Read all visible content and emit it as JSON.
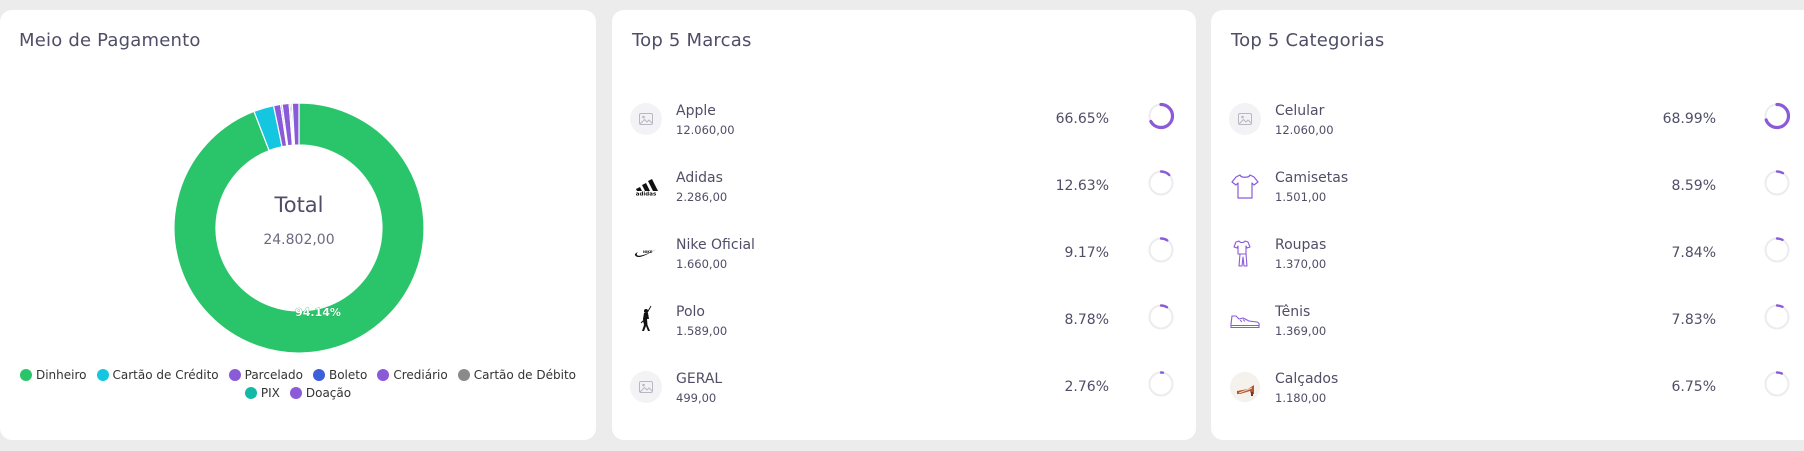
{
  "payment": {
    "title": "Meio de Pagamento",
    "center_title": "Total",
    "center_value": "24.802,00",
    "slice_label": "94.14%"
  },
  "chart_data": {
    "type": "pie",
    "title": "Meio de Pagamento",
    "hole": true,
    "slices": [
      {
        "name": "Dinheiro",
        "value": 94.14,
        "color": "#2ac56a"
      },
      {
        "name": "Cartão de Crédito",
        "value": 2.6,
        "color": "#15c6e0"
      },
      {
        "name": "Parcelado",
        "value": 0.9,
        "color": "#8a5ad8"
      },
      {
        "name": "Boleto",
        "value": 0.2,
        "color": "#3d5fd9"
      },
      {
        "name": "Crediário",
        "value": 0.9,
        "color": "#8a5ad8"
      },
      {
        "name": "Cartão de Débito",
        "value": 0.2,
        "color": "#8a8a8a"
      },
      {
        "name": "PIX",
        "value": 0.2,
        "color": "#14b8a6"
      },
      {
        "name": "Doação",
        "value": 0.86,
        "color": "#8a5ad8"
      }
    ],
    "legend": {
      "row1": [
        {
          "name": "Dinheiro",
          "color": "#2ac56a"
        },
        {
          "name": "Cartão de Crédito",
          "color": "#15c6e0"
        },
        {
          "name": "Parcelado",
          "color": "#8a5ad8"
        },
        {
          "name": "Boleto",
          "color": "#3d5fd9"
        },
        {
          "name": "Crediário",
          "color": "#8a5ad8"
        },
        {
          "name": "Cartão de Débito",
          "color": "#8a8a8a"
        }
      ],
      "row2": [
        {
          "name": "PIX",
          "color": "#14b8a6"
        },
        {
          "name": "Doação",
          "color": "#8a5ad8"
        }
      ]
    }
  },
  "brands": {
    "title": "Top 5 Marcas",
    "items": [
      {
        "name": "Apple",
        "value": "12.060,00",
        "percent": "66.65%",
        "pct_num": 66.65,
        "icon": "image-placeholder-icon"
      },
      {
        "name": "Adidas",
        "value": "2.286,00",
        "percent": "12.63%",
        "pct_num": 12.63,
        "icon": "adidas-logo-icon"
      },
      {
        "name": "Nike Oficial",
        "value": "1.660,00",
        "percent": "9.17%",
        "pct_num": 9.17,
        "icon": "nike-logo-icon"
      },
      {
        "name": "Polo",
        "value": "1.589,00",
        "percent": "8.78%",
        "pct_num": 8.78,
        "icon": "polo-logo-icon"
      },
      {
        "name": "GERAL",
        "value": "499,00",
        "percent": "2.76%",
        "pct_num": 2.76,
        "icon": "image-placeholder-icon"
      }
    ]
  },
  "categories": {
    "title": "Top 5 Categorias",
    "items": [
      {
        "name": "Celular",
        "value": "12.060,00",
        "percent": "68.99%",
        "pct_num": 68.99,
        "icon": "image-placeholder-icon"
      },
      {
        "name": "Camisetas",
        "value": "1.501,00",
        "percent": "8.59%",
        "pct_num": 8.59,
        "icon": "tshirt-icon"
      },
      {
        "name": "Roupas",
        "value": "1.370,00",
        "percent": "7.84%",
        "pct_num": 7.84,
        "icon": "clothes-icon"
      },
      {
        "name": "Tênis",
        "value": "1.369,00",
        "percent": "7.83%",
        "pct_num": 7.83,
        "icon": "sneaker-icon"
      },
      {
        "name": "Calçados",
        "value": "1.180,00",
        "percent": "6.75%",
        "pct_num": 6.75,
        "icon": "sandal-icon"
      }
    ]
  },
  "colors": {
    "accent": "#8a5ad8",
    "ring_track": "#ececf0"
  }
}
